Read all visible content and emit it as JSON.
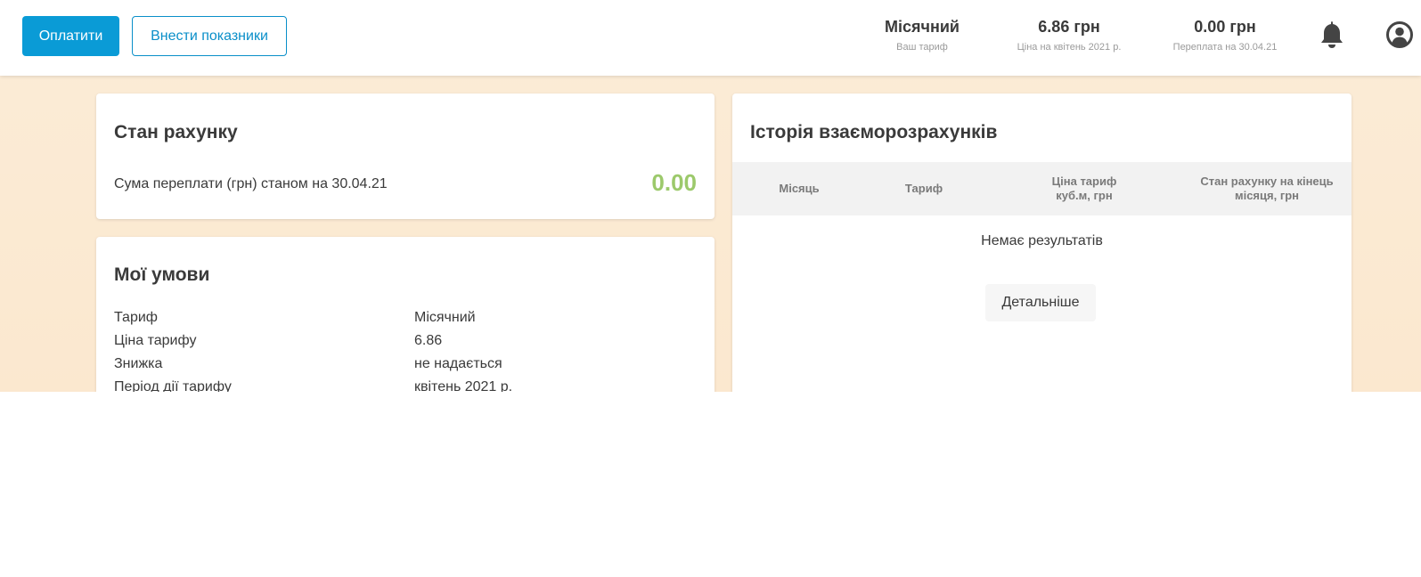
{
  "header": {
    "pay_button": "Оплатити",
    "meters_button": "Внести показники",
    "stats": [
      {
        "value": "Місячний",
        "label": "Ваш тариф"
      },
      {
        "value": "6.86 грн",
        "label": "Ціна на квітень 2021 р."
      },
      {
        "value": "0.00 грн",
        "label": "Переплата на 30.04.21"
      }
    ],
    "icons": {
      "notifications": "bell-icon",
      "profile": "user-circle-icon"
    }
  },
  "account": {
    "title": "Стан рахунку",
    "overpay_label": "Сума переплати (грн) станом на 30.04.21",
    "overpay_value": "0.00",
    "accent_color": "#9cc96b"
  },
  "terms": {
    "title": "Мої умови",
    "rows": [
      {
        "label": "Тариф",
        "value": "Місячний"
      },
      {
        "label": "Ціна тарифу",
        "value": "6.86"
      },
      {
        "label": "Знижка",
        "value": "не надається"
      },
      {
        "label": "Період дії тарифу",
        "value": "квітень 2021 р."
      }
    ]
  },
  "history": {
    "title": "Історія взаєморозрахунків",
    "columns": [
      "Місяць",
      "Тариф",
      "Ціна тариф куб.м, грн",
      "Стан рахунку на кінець місяця, грн"
    ],
    "columns_display": [
      [
        "Місяць"
      ],
      [
        "Тариф"
      ],
      [
        "Ціна тариф",
        "куб.м, грн"
      ],
      [
        "Стан рахунку на кінець",
        "місяця, грн"
      ]
    ],
    "empty_text": "Немає результатів",
    "details_button": "Детальніше"
  },
  "colors": {
    "primary": "#0a9bd6",
    "background": "#fbecd7"
  }
}
